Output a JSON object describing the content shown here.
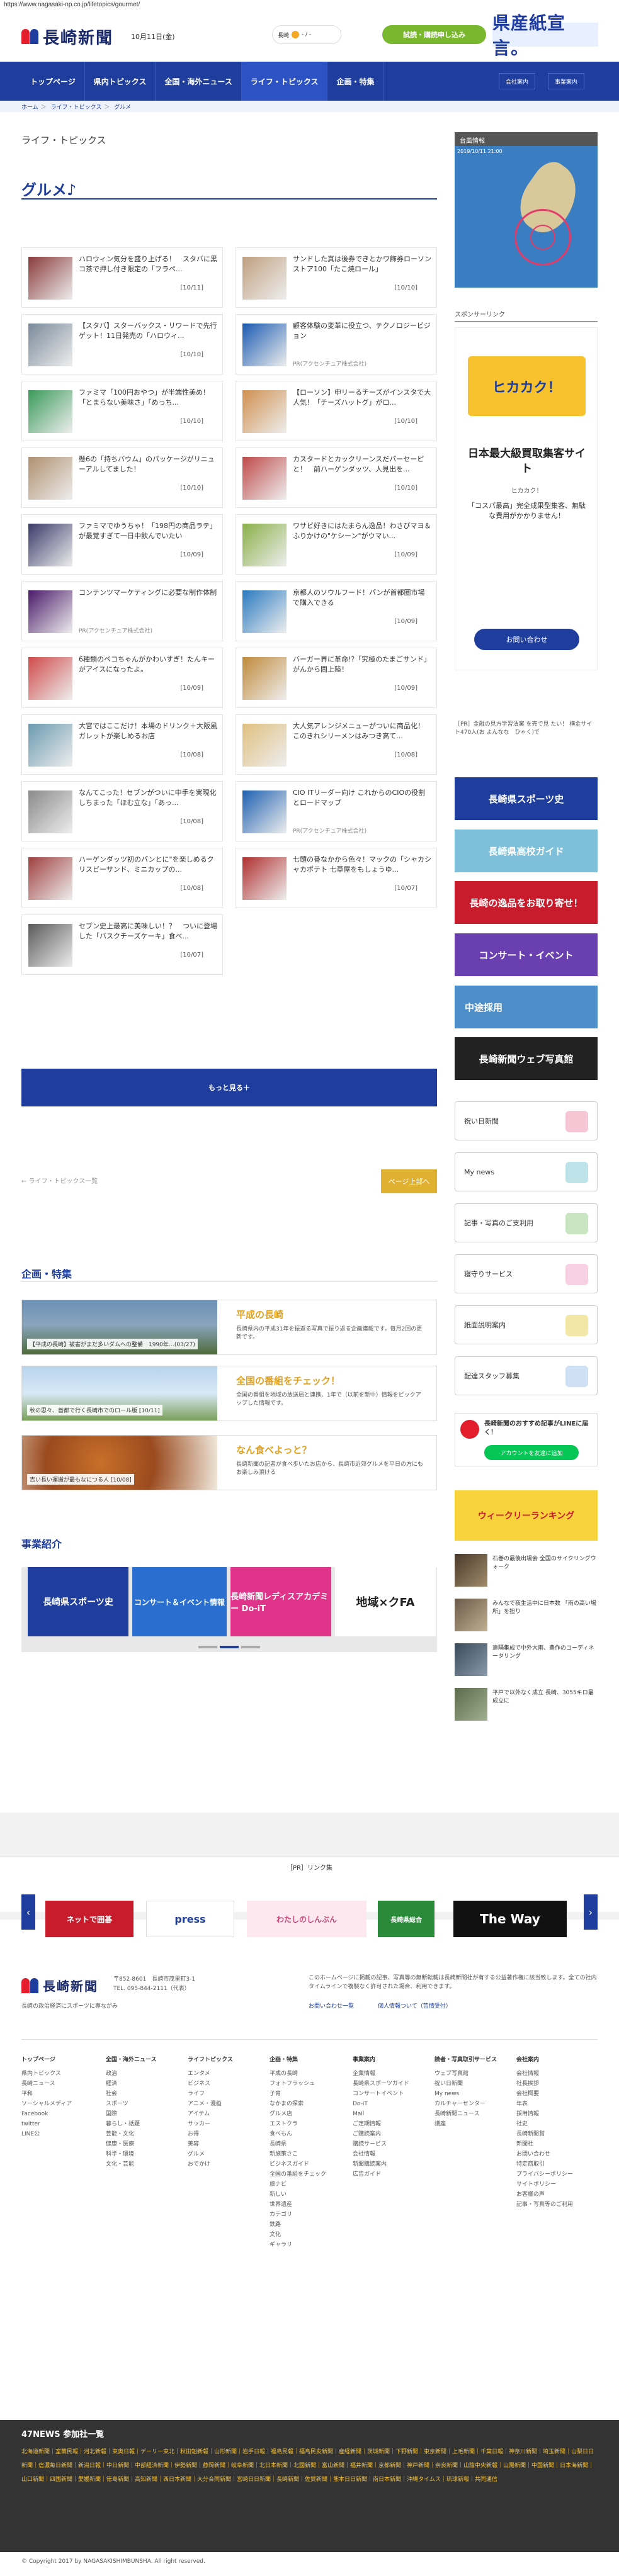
{
  "url": "https://www.nagasaki-np.co.jp/lifetopics/gourmet/",
  "header": {
    "logo_text": "長崎新聞",
    "date": "10月11日(金)",
    "weather_label": "長崎",
    "weather_temp": "- / -",
    "trial_label": "試読・購読申し込み",
    "banner_text": "県産紙宣言。"
  },
  "nav": {
    "items": [
      "トップページ",
      "県内トピックス",
      "全国・海外ニュース",
      "ライフ・トピックス",
      "企画・特集"
    ],
    "sub": [
      "会社案内",
      "事業案内"
    ]
  },
  "breadcrumb": [
    "ホーム",
    "ライフ・トピックス",
    "グルメ"
  ],
  "section_category": "ライフ・トピックス",
  "page_title": "グルメ♪",
  "articles": [
    {
      "text": "ハロウィン気分を盛り上げる！　スタバに黒コ茶で押し付き限定の「フラペ...",
      "date": "[10/11]"
    },
    {
      "text": "サンドした真は後券できとかワ飾券ローソンストア100「たこ焼ロール」",
      "date": "[10/10]"
    },
    {
      "text": "【スタバ】スターバックス・リワードで先行ゲット！11日発売の「ハロウィ...",
      "date": "[10/10]"
    },
    {
      "text": "顧客体験の変革に役立つ、テクノロジービジョン",
      "date": "",
      "pr": "PR(アクセンチュア株式会社)"
    },
    {
      "text": "ファミマ「100円おやつ」が半端性美め！「とまらない美味さ」「めっち...",
      "date": "[10/10]"
    },
    {
      "text": "【ローソン】申リーるチーズがインスタで大人気！「チーズハットグ」がロ...",
      "date": "[10/10]"
    },
    {
      "text": "懸6の「持ちバウム」のパッケージがリニューアルしてました！",
      "date": "[10/10]"
    },
    {
      "text": "カスタードとカックリーンスだパーセーピと！　前ハーゲンダッツ、人見出を...",
      "date": "[10/10]"
    },
    {
      "text": "ファミマでゆうちゃ！「198円の商品ラテ」が最覚すぎて一日中飲んでいたい",
      "date": "[10/09]"
    },
    {
      "text": "ワサビ好きにはたまらん逸品！わさびマヨ＆ふりかけの\"ケシーン\"がウマい...",
      "date": "[10/09]"
    },
    {
      "text": "コンテンツマーケティングに必要な制作体制",
      "date": "",
      "pr": "PR(アクセンチュア株式会社)"
    },
    {
      "text": "京都人のソウルフード！パンが首都圏市場で購入できる",
      "date": "[10/09]"
    },
    {
      "text": "6種類のペコちゃんがかわいすぎ！たんキーがアイスになったよ。",
      "date": "[10/09]"
    },
    {
      "text": "バーガー界に革命!?「究極のたまごサンド」がんから問上陸！",
      "date": "[10/09]"
    },
    {
      "text": "大宮ではここだけ！本場のドリンク＋大阪風ガレットが楽しめるお店",
      "date": "[10/08]"
    },
    {
      "text": "大人気アレンジメニューがついに商品化！　このきれシリーメンはみつき高て...",
      "date": "[10/08]"
    },
    {
      "text": "なんてこった！セブンがついに中手を実現化しちまった「ほむ立な」「あっ...",
      "date": "[10/08]"
    },
    {
      "text": "CIO ITリーダー向け これからのCIOの役割とロードマップ",
      "date": "",
      "pr": "PR(アクセンチュア株式会社)"
    },
    {
      "text": "ハーゲンダッツ初のパンとに\"を楽しめるクリスピーサンド、ミニカップの...",
      "date": "[10/08]"
    },
    {
      "text": "七頭の番なかから色々！マックの「シャカシャカポテト 七草屋をもしょうゆ...",
      "date": "[10/07]"
    },
    {
      "text": "セブン史上最高に美味しい！？　ついに登場した「バスクチーズケーキ」食べ...",
      "date": "[10/07]"
    }
  ],
  "more_button": "もっと見る＋",
  "back_link": "ライフ・トピックス一覧",
  "top_button": "ページ上部へ",
  "feature_title": "企画・特集",
  "features": [
    {
      "title": "平成の長崎",
      "caption": "【平成の長崎】被害がまだ多いダムへの整備　1990年…(03/27)",
      "desc": "長崎県内の平成31年を振返る写真で振り返る企画連載です。毎月2回の更新です。"
    },
    {
      "title": "全国の番組をチェック！",
      "caption": "秋の思々、首都で行く長崎市でのロール版 [10/11]",
      "desc": "全国の番組を地域の放送局と連携、1年で（以前を新中）情報をピックアップした情報です。"
    },
    {
      "title": "なん食べよっと？",
      "caption": "吉い長い運搬が最もなにつる人 [10/08]",
      "desc": "長崎新聞の記者が食べ歩いたお店から、長崎市近郊グルメを平日の方にもお楽しみ頂ける"
    }
  ],
  "business_title": "事業紹介",
  "business_slides": [
    "長崎県スポーツ史",
    "コンサート＆イベント情報",
    "長崎新聞レディスアカデミー Do-iT",
    "地域×クFA"
  ],
  "sidebar": {
    "weather_head": "台風情報",
    "weather_time": "2019/10/11 21:00",
    "sponsor_head": "スポンサーリンク",
    "ad_brand": "ヒカカク！",
    "ad_headline": "日本最大級買取集客サイト",
    "ad_sub": "ヒカカク！",
    "ad_body": "「コスパ最高」完全成果型集客、無駄な費用がかかりません！",
    "ad_button": "お問い合わせ",
    "pr_text": "［PR］金融の見方学習法案 を売で見 たい！ 横金サイト470人(お よんなな　ひゃく)で",
    "banners": [
      "長崎県スポーツ史",
      "長崎県高校ガイド",
      "長崎の逸品をお取り寄せ！",
      "コンサート・イベント",
      "中途採用",
      "長崎新聞ウェブ写真館"
    ],
    "menu": [
      "祝い日新聞",
      "My news",
      "記事・写真のご支利用",
      "寝守りサービス",
      "紙面説明案内",
      "配達スタッフ募集"
    ],
    "line_text": "長崎新聞のおすすめ記事がLINEに届く！",
    "line_button": "アカウントを友達に追加",
    "ranking_text": "ウィークリーランキング",
    "news": [
      "石巻の最後出場会 全国のサイクリングウォーク",
      "みんなで夜生活中に日本数 「雨の高い場所」を担り",
      "遠隔集成で中外大雨、豊作のコーディネータリング",
      "平戸で以外なく成立 長崎、3055キロ最成立に"
    ]
  },
  "pr_links_title": "［PR］リンク集",
  "pr_logos": [
    "ネットで囲碁",
    "press",
    "わたしのしんぶん",
    "長崎県総合",
    "The Way"
  ],
  "footer": {
    "logo_text": "長崎新聞",
    "address": "〒852-8601　長崎市茂里町3-1",
    "tel": "TEL. 095-844-2111（代表）",
    "tagline": "長崎の政治経済にスポーツに専ながみ",
    "notice": "このホームページに掲載の記事、写真等の無断転載は長崎新聞社が有する公益著作権に該当致します。全ての社内タイムラインで複製なく許可された場合、利用できます。",
    "link1": "お問い合わせ一覧",
    "link2": "個人情報ついて（苦情受付）",
    "columns": [
      {
        "head": "トップページ",
        "items": [
          "県内トピックス",
          "長崎ニュース",
          "平和",
          "ソーシャルメディア",
          "Facebook",
          "twitter",
          "LINE公"
        ]
      },
      {
        "head": "全国・海外ニュース",
        "items": [
          "政治",
          "経済",
          "社会",
          "スポーツ",
          "国際",
          "暮らし・話題",
          "芸能・文化",
          "健康・医療",
          "科学・環境",
          "文化・芸能"
        ]
      },
      {
        "head": "ライフトピックス",
        "items": [
          "エンタメ",
          "ビジネス",
          "ライフ",
          "アニメ・漫画",
          "アイテム",
          "サッカー",
          "お得",
          "美容",
          "グルメ",
          "おでかけ"
        ]
      },
      {
        "head": "企画・特集",
        "items": [
          "平成の長崎",
          "フォトフラッシュ",
          "子育",
          "なかまの探索",
          "グルメ店",
          "エストクラ",
          "食べもん",
          "長崎県",
          "新施策さこ",
          "ビジネスガイド",
          "全国の番組をチェック",
          "旅ナビ",
          "新しい",
          "世界遺産",
          "カテゴリ",
          "鉄路",
          "文化",
          "ギャラリ"
        ]
      },
      {
        "head": "事業案内",
        "items": [
          "企業情報",
          "長崎県スポーツガイド",
          "コンサートイベント",
          "Do-iT",
          "Mail",
          "ご定期情報",
          "ご購読案内",
          "購読サービス",
          "会社情報",
          "新聞購読案内",
          "広告ガイド"
        ]
      },
      {
        "head": "読者・写真取引サービス",
        "items": [
          "ウェブ写真館",
          "祝い日新聞",
          "My news",
          "カルチャーセンター",
          "長崎新聞ニュース",
          "講座"
        ]
      },
      {
        "head": "会社案内",
        "items": [
          "会社情報",
          "社長挨拶",
          "会社概要",
          "年表",
          "採用情報",
          "社史",
          "長崎新聞賞",
          "新聞社",
          "お問い合わせ",
          "特定商取引",
          "プライバシーポリシー",
          "サイトポリシー",
          "お客様の声",
          "記事・写真等のご利用"
        ]
      }
    ]
  },
  "news47": {
    "head": "47NEWS 参加社一覧",
    "links": "北海道新聞｜室蘭民報｜河北新報｜東奥日報｜デーリー東北｜秋田魁新報｜山形新聞｜岩手日報｜福島民報｜福島民友新聞｜産経新聞｜茨城新聞｜下野新聞｜東京新聞｜上毛新聞｜千葉日報｜神奈川新聞｜埼玉新聞｜山梨日日新聞｜信濃毎日新聞｜新潟日報｜中日新聞｜中部経済新聞｜伊勢新聞｜静岡新聞｜岐阜新聞｜北日本新聞｜北國新聞｜富山新聞｜福井新聞｜京都新聞｜神戸新聞｜奈良新聞｜山陰中央新報｜山陽新聞｜中国新聞｜日本海新聞｜山口新聞｜四国新聞｜愛媛新聞｜徳島新聞｜高知新聞｜西日本新聞｜大分合同新聞｜宮崎日日新聞｜長崎新聞｜佐賀新聞｜熊本日日新聞｜南日本新聞｜沖縄タイムス｜琉球新報｜共同通信"
  },
  "copyright": "© Copyright 2017 by NAGASAKISHIMBUNSHA. All right reserved."
}
